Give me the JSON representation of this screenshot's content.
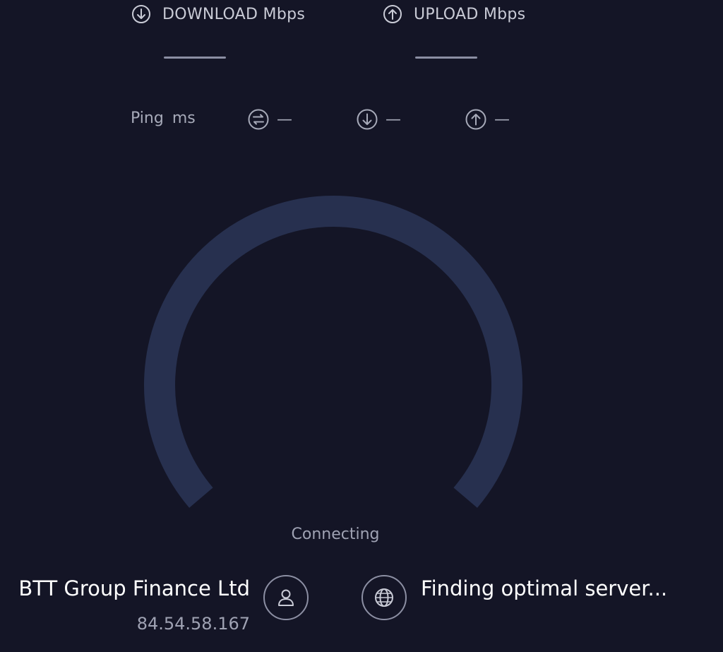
{
  "metrics": {
    "download": {
      "label": "DOWNLOAD Mbps",
      "icon": "arrow-down-circle-icon"
    },
    "upload": {
      "label": "UPLOAD Mbps",
      "icon": "arrow-up-circle-icon"
    }
  },
  "ping": {
    "label": "Ping",
    "unit": "ms",
    "idle_value": "—",
    "download_value": "—",
    "upload_value": "—"
  },
  "gauge": {
    "status": "Connecting"
  },
  "isp": {
    "name": "BTT Group Finance Ltd",
    "ip": "84.54.58.167"
  },
  "server": {
    "text": "Finding optimal server..."
  },
  "colors": {
    "background": "#141526",
    "gauge_track": "#27304f",
    "text_primary": "#ffffff",
    "text_secondary": "#9fa2b3"
  }
}
